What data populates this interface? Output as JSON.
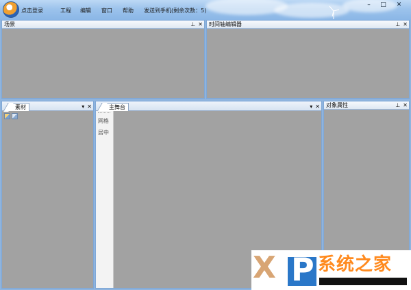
{
  "app": {
    "login_label": "点击登录"
  },
  "menu": {
    "items": [
      {
        "label": "工程"
      },
      {
        "label": "编辑"
      },
      {
        "label": "窗口"
      },
      {
        "label": "帮助"
      },
      {
        "label": "发送到手机(剩余次数：5)"
      }
    ]
  },
  "window_controls": {
    "minimize": "–",
    "maximize": "□",
    "close": "✕"
  },
  "panels": {
    "scene": {
      "title": "场景"
    },
    "timeline": {
      "title": "时间轴编辑器"
    },
    "assets": {
      "tab": "素材"
    },
    "stage": {
      "tab": "主舞台",
      "tools": [
        {
          "label": "网格"
        },
        {
          "label": "居中"
        }
      ]
    },
    "properties": {
      "title": "对象属性"
    }
  },
  "panel_buttons": {
    "pin": "⊥",
    "close": "✕",
    "dropdown": "▾"
  },
  "watermark": {
    "logo_letters": "XP",
    "text": "系统之家"
  },
  "icons": {
    "app_logo": "app-logo-icon",
    "windmill": "windmill-icon",
    "asset_import": "import-icon",
    "asset_folder": "folder-icon"
  },
  "colors": {
    "titlebar": "#9cc3ec",
    "panel_body": "#a2a2a2",
    "panel_border": "#7fa7d6",
    "window_bg": "#8fb4de",
    "watermark_orange": "#ff8a1e",
    "watermark_blue": "#2a77c8"
  }
}
